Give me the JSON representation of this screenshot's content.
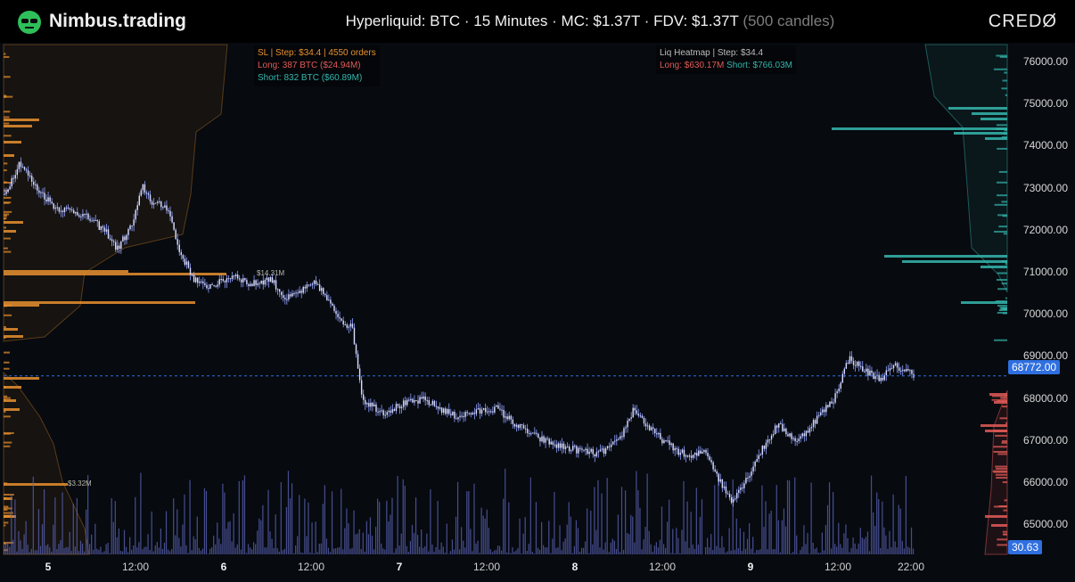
{
  "header": {
    "brand": "Nimbus.trading",
    "title_main": "Hyperliquid: BTC · 15 Minutes · MC: $1.37T · FDV: $1.37T",
    "title_muted": "(500 candles)",
    "logo_right": "CREDØ"
  },
  "sl_panel": {
    "line1": "SL | Step: $34.4 | 4550 orders",
    "line2": "Long: 387 BTC ($24.94M)",
    "line3": "Short: 832 BTC ($60.89M)"
  },
  "liq_panel": {
    "line1": "Liq Heatmap | Step: $34.4",
    "long": "Long: $630.17M",
    "short": "Short: $766.03M"
  },
  "tags": {
    "top": "$14.31M",
    "bottom": "$3.32M"
  },
  "price_axis": [
    "76000.00",
    "75000.00",
    "74000.00",
    "73000.00",
    "72000.00",
    "71000.00",
    "70000.00",
    "69000.00",
    "68000.00",
    "67000.00",
    "66000.00",
    "65000.00"
  ],
  "current_price": "68772.00",
  "volume_value": "30.63",
  "time_axis": [
    {
      "label": "5",
      "bold": true
    },
    {
      "label": "12:00",
      "bold": false
    },
    {
      "label": "6",
      "bold": true
    },
    {
      "label": "12:00",
      "bold": false
    },
    {
      "label": "7",
      "bold": true
    },
    {
      "label": "12:00",
      "bold": false
    },
    {
      "label": "8",
      "bold": true
    },
    {
      "label": "12:00",
      "bold": false
    },
    {
      "label": "9",
      "bold": true
    },
    {
      "label": "12:00",
      "bold": false
    },
    {
      "label": "22:00",
      "bold": false
    }
  ],
  "colors": {
    "candle": "#d8dcff",
    "orange": "#e8902f",
    "teal": "#35b6ad",
    "red": "#e25b57",
    "accent": "#2f6fe0"
  },
  "chart_data": {
    "type": "line",
    "anchors": [
      [
        0,
        73100
      ],
      [
        3,
        73900
      ],
      [
        6,
        73300
      ],
      [
        10,
        72800
      ],
      [
        14,
        72700
      ],
      [
        17,
        72500
      ],
      [
        20,
        72200
      ],
      [
        22,
        71800
      ],
      [
        25,
        72400
      ],
      [
        27,
        73300
      ],
      [
        29,
        72900
      ],
      [
        32,
        72800
      ],
      [
        34,
        71800
      ],
      [
        37,
        71100
      ],
      [
        39,
        70900
      ],
      [
        42,
        71000
      ],
      [
        45,
        71200
      ],
      [
        48,
        70950
      ],
      [
        52,
        71100
      ],
      [
        55,
        70600
      ],
      [
        58,
        70800
      ],
      [
        61,
        71000
      ],
      [
        64,
        70400
      ],
      [
        66,
        70100
      ],
      [
        68,
        69900
      ],
      [
        70,
        68200
      ],
      [
        74,
        67900
      ],
      [
        78,
        68100
      ],
      [
        82,
        68200
      ],
      [
        85,
        68000
      ],
      [
        88,
        67800
      ],
      [
        92,
        67900
      ],
      [
        96,
        68000
      ],
      [
        100,
        67600
      ],
      [
        104,
        67300
      ],
      [
        108,
        67100
      ],
      [
        112,
        67000
      ],
      [
        116,
        66900
      ],
      [
        120,
        67200
      ],
      [
        123,
        68000
      ],
      [
        126,
        67500
      ],
      [
        130,
        67100
      ],
      [
        134,
        66800
      ],
      [
        137,
        67000
      ],
      [
        140,
        66200
      ],
      [
        142,
        65800
      ],
      [
        145,
        66300
      ],
      [
        147,
        66800
      ],
      [
        151,
        67600
      ],
      [
        155,
        67200
      ],
      [
        159,
        67800
      ],
      [
        162,
        68200
      ],
      [
        165,
        69200
      ],
      [
        168,
        68900
      ],
      [
        171,
        68700
      ],
      [
        174,
        69000
      ],
      [
        176,
        68900
      ],
      [
        178,
        68800
      ]
    ],
    "price_range": [
      64500,
      76700
    ],
    "volume_max": 100
  }
}
